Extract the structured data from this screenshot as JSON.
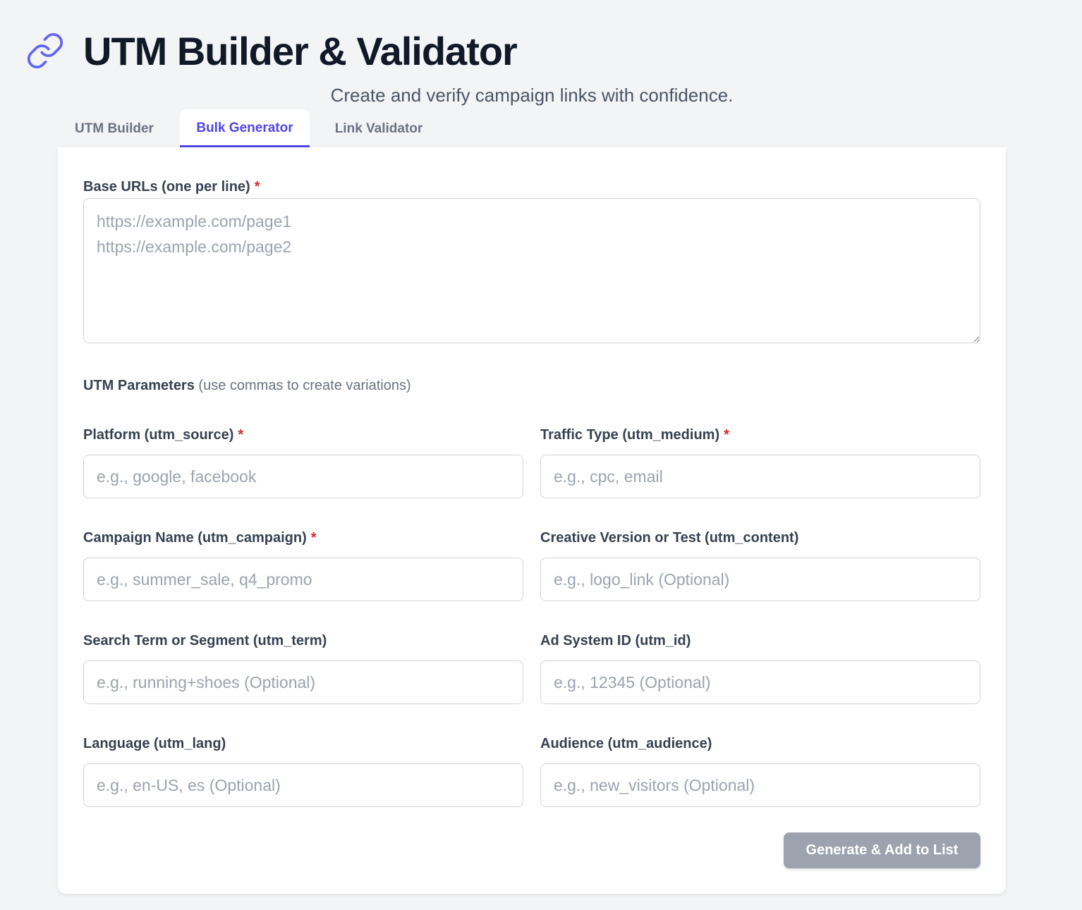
{
  "header": {
    "logo_icon": "link-icon",
    "title": "UTM Builder & Validator",
    "subtitle": "Create and verify campaign links with confidence."
  },
  "tabs": [
    {
      "label": "UTM Builder",
      "active": false
    },
    {
      "label": "Bulk Generator",
      "active": true
    },
    {
      "label": "Link Validator",
      "active": false
    }
  ],
  "form": {
    "base_urls": {
      "label": "Base URLs (one per line)",
      "required_mark": "*",
      "value": "",
      "placeholder": "https://example.com/page1\nhttps://example.com/page2"
    },
    "utm_section": {
      "title": "UTM Parameters",
      "hint": "(use commas to create variations)"
    },
    "fields": [
      {
        "key": "utm_source",
        "label": "Platform (utm_source)",
        "required": true,
        "value": "",
        "placeholder": "e.g., google, facebook"
      },
      {
        "key": "utm_medium",
        "label": "Traffic Type (utm_medium)",
        "required": true,
        "value": "",
        "placeholder": "e.g., cpc, email"
      },
      {
        "key": "utm_campaign",
        "label": "Campaign Name (utm_campaign)",
        "required": true,
        "value": "",
        "placeholder": "e.g., summer_sale, q4_promo"
      },
      {
        "key": "utm_content",
        "label": "Creative Version or Test (utm_content)",
        "required": false,
        "value": "",
        "placeholder": "e.g., logo_link (Optional)"
      },
      {
        "key": "utm_term",
        "label": "Search Term or Segment (utm_term)",
        "required": false,
        "value": "",
        "placeholder": "e.g., running+shoes (Optional)"
      },
      {
        "key": "utm_id",
        "label": "Ad System ID (utm_id)",
        "required": false,
        "value": "",
        "placeholder": "e.g., 12345 (Optional)"
      },
      {
        "key": "utm_lang",
        "label": "Language (utm_lang)",
        "required": false,
        "value": "",
        "placeholder": "e.g., en-US, es (Optional)"
      },
      {
        "key": "utm_audience",
        "label": "Audience (utm_audience)",
        "required": false,
        "value": "",
        "placeholder": "e.g., new_visitors (Optional)"
      }
    ],
    "required_mark": "*",
    "submit_label": "Generate & Add to List"
  },
  "colors": {
    "accent": "#4f46e5",
    "required": "#dc2626",
    "disabled_button": "#9ca3af",
    "background": "#f3f4f6"
  }
}
